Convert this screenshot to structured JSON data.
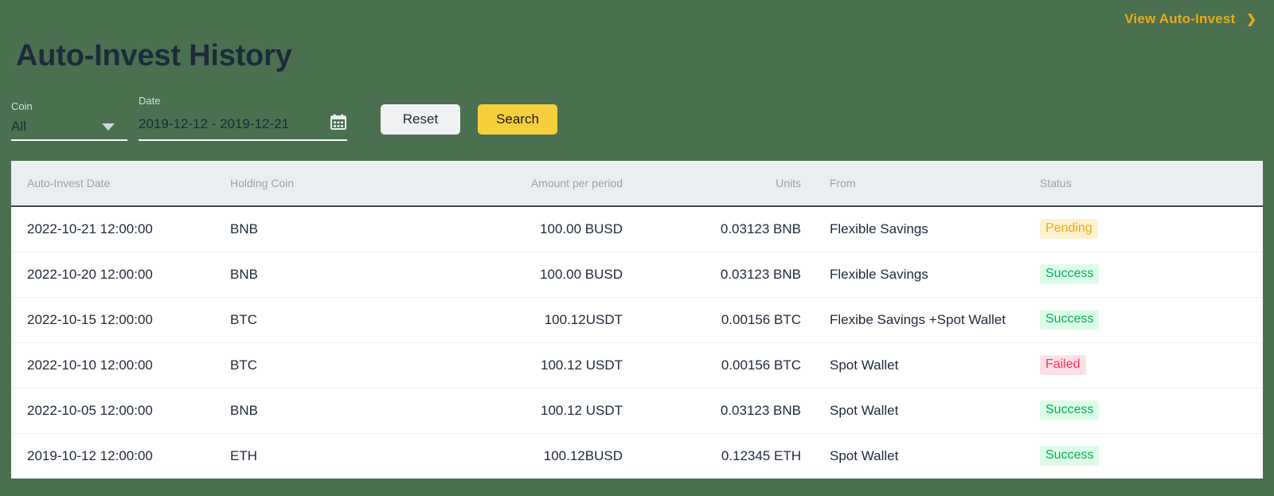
{
  "top_link": {
    "label": "View Auto-Invest",
    "chevron": "❯"
  },
  "page_title": "Auto-Invest History",
  "filters": {
    "coin": {
      "label": "Coin",
      "value": "All",
      "caret_icon": "chevron-down-icon"
    },
    "date": {
      "label": "Date",
      "value": "2019-12-12 - 2019-12-21",
      "calendar_icon": "calendar-icon"
    },
    "reset_label": "Reset",
    "search_label": "Search"
  },
  "table": {
    "columns": [
      "Auto-Invest Date",
      "Holding Coin",
      "Amount per period",
      "Units",
      "From",
      "Status"
    ],
    "rows": [
      {
        "date": "2022-10-21  12:00:00",
        "coin": "BNB",
        "amount": "100.00 BUSD",
        "units": "0.03123 BNB",
        "from": "Flexible Savings",
        "status": "Pending",
        "status_kind": "pending"
      },
      {
        "date": "2022-10-20  12:00:00",
        "coin": "BNB",
        "amount": "100.00 BUSD",
        "units": "0.03123 BNB",
        "from": "Flexible Savings",
        "status": "Success",
        "status_kind": "success"
      },
      {
        "date": "2022-10-15  12:00:00",
        "coin": "BTC",
        "amount": "100.12USDT",
        "units": "0.00156 BTC",
        "from": "Flexibe Savings +Spot Wallet",
        "status": "Success",
        "status_kind": "success"
      },
      {
        "date": "2022-10-10  12:00:00",
        "coin": "BTC",
        "amount": "100.12 USDT",
        "units": "0.00156 BTC",
        "from": "Spot Wallet",
        "status": "Failed",
        "status_kind": "failed"
      },
      {
        "date": "2022-10-05  12:00:00",
        "coin": "BNB",
        "amount": "100.12 USDT",
        "units": "0.03123 BNB",
        "from": "Spot Wallet",
        "status": "Success",
        "status_kind": "success"
      },
      {
        "date": "2019-10-12  12:00:00",
        "coin": "ETH",
        "amount": "100.12BUSD",
        "units": "0.12345 ETH",
        "from": "Spot Wallet",
        "status": "Success",
        "status_kind": "success"
      }
    ]
  },
  "colors": {
    "background": "#4a7050",
    "accent_yellow": "#f6d03c",
    "link_yellow": "#e8ac18",
    "title_navy": "#1e2a3a",
    "header_bg": "#ebeef0",
    "success": "#06b050",
    "pending": "#e8ac18",
    "failed": "#f6335c"
  }
}
